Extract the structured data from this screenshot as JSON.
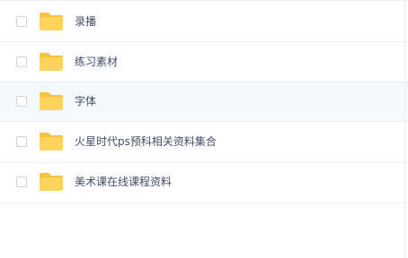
{
  "files": [
    {
      "name": "录播",
      "icon": "folder-icon",
      "selected": false
    },
    {
      "name": "练习素材",
      "icon": "folder-icon",
      "selected": false
    },
    {
      "name": "字体",
      "icon": "folder-icon",
      "selected": false,
      "hovered": true
    },
    {
      "name": "火星时代ps预科相关资料集合",
      "icon": "folder-icon",
      "selected": false
    },
    {
      "name": "美术课在线课程资料",
      "icon": "folder-icon",
      "selected": false
    }
  ],
  "colors": {
    "folder": "#FFD35C",
    "folder_tab": "#F9C23C",
    "text": "#424E67",
    "hover_row": "#F4F9FE",
    "divider": "#F0F2F4"
  }
}
